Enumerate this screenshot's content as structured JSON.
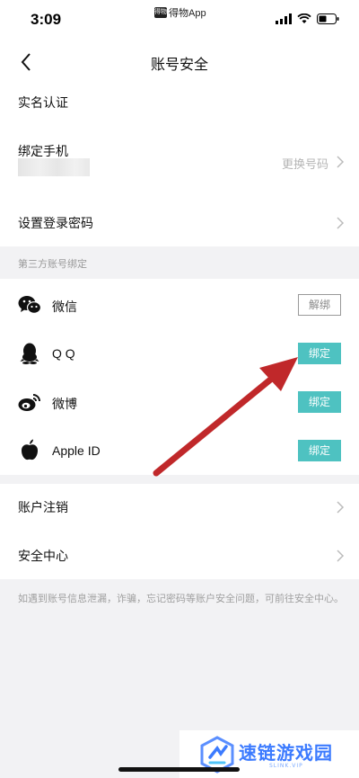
{
  "status_bar": {
    "time": "3:09",
    "app_badge": "得物",
    "app_name": "得物App"
  },
  "nav": {
    "title": "账号安全"
  },
  "account": {
    "real_name": "实名认证",
    "bind_phone": "绑定手机",
    "change_number": "更换号码",
    "set_password": "设置登录密码"
  },
  "third_party": {
    "header": "第三方账号绑定",
    "items": [
      {
        "name": "微信",
        "action": "解绑",
        "icon": "wechat-icon"
      },
      {
        "name": "Q Q",
        "action": "绑定",
        "icon": "qq-icon"
      },
      {
        "name": "微博",
        "action": "绑定",
        "icon": "weibo-icon"
      },
      {
        "name": "Apple ID",
        "action": "绑定",
        "icon": "apple-icon"
      }
    ]
  },
  "more": {
    "cancel_account": "账户注销",
    "security_center": "安全中心"
  },
  "footer_note": "如遇到账号信息泄漏，诈骗，忘记密码等账户安全问题，可前往安全中心。",
  "watermark": {
    "text": "速链游戏园",
    "sub": "SLINK.VIP"
  },
  "colors": {
    "accent": "#4ec2c1",
    "arrow": "#c0282a",
    "background": "#f2f2f4"
  }
}
